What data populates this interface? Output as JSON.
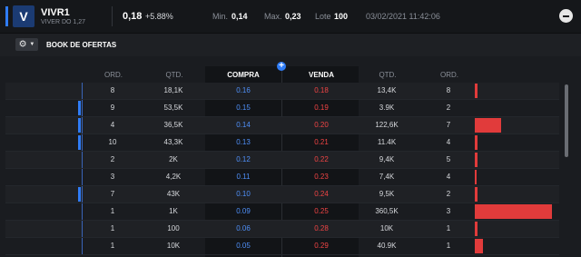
{
  "header": {
    "ticker": "VIVR1",
    "company": "VIVER DO 1,27",
    "logo_glyph": "V",
    "price": "0,18",
    "change": "+5.88%",
    "min_label": "Min.",
    "min_value": "0,14",
    "max_label": "Max.",
    "max_value": "0,23",
    "lote_label": "Lote",
    "lote_value": "100",
    "datetime": "03/02/2021  11:42:06",
    "collapse_icon": "minus-circle-icon"
  },
  "toolbar": {
    "gear_glyph": "⚙",
    "caret_glyph": "▼",
    "title": "BOOK DE OFERTAS"
  },
  "book": {
    "add_glyph": "+",
    "columns": [
      "ORD.",
      "QTD.",
      "COMPRA",
      "VENDA",
      "QTD.",
      "ORD."
    ],
    "rows": [
      {
        "buy_ord": "8",
        "buy_qty": "18,1K",
        "buy_price": "0.16",
        "sell_price": "0.18",
        "sell_qty": "13,4K",
        "sell_ord": "8",
        "mark": false,
        "bar": 0.04
      },
      {
        "buy_ord": "9",
        "buy_qty": "53,5K",
        "buy_price": "0.15",
        "sell_price": "0.19",
        "sell_qty": "3.9K",
        "sell_ord": "2",
        "mark": true,
        "bar": 0.0
      },
      {
        "buy_ord": "4",
        "buy_qty": "36,5K",
        "buy_price": "0.14",
        "sell_price": "0.20",
        "sell_qty": "122,6K",
        "sell_ord": "7",
        "mark": true,
        "bar": 0.34
      },
      {
        "buy_ord": "10",
        "buy_qty": "43,3K",
        "buy_price": "0.13",
        "sell_price": "0.21",
        "sell_qty": "11.4K",
        "sell_ord": "4",
        "mark": true,
        "bar": 0.03
      },
      {
        "buy_ord": "2",
        "buy_qty": "2K",
        "buy_price": "0.12",
        "sell_price": "0.22",
        "sell_qty": "9,4K",
        "sell_ord": "5",
        "mark": false,
        "bar": 0.03
      },
      {
        "buy_ord": "3",
        "buy_qty": "4,2K",
        "buy_price": "0.11",
        "sell_price": "0.23",
        "sell_qty": "7,4K",
        "sell_ord": "4",
        "mark": false,
        "bar": 0.02
      },
      {
        "buy_ord": "7",
        "buy_qty": "43K",
        "buy_price": "0.10",
        "sell_price": "0.24",
        "sell_qty": "9,5K",
        "sell_ord": "2",
        "mark": true,
        "bar": 0.03
      },
      {
        "buy_ord": "1",
        "buy_qty": "1K",
        "buy_price": "0.09",
        "sell_price": "0.25",
        "sell_qty": "360,5K",
        "sell_ord": "3",
        "mark": false,
        "bar": 1.0
      },
      {
        "buy_ord": "1",
        "buy_qty": "100",
        "buy_price": "0.06",
        "sell_price": "0.28",
        "sell_qty": "10K",
        "sell_ord": "1",
        "mark": false,
        "bar": 0.03
      },
      {
        "buy_ord": "1",
        "buy_qty": "10K",
        "buy_price": "0.05",
        "sell_price": "0.29",
        "sell_qty": "40.9K",
        "sell_ord": "1",
        "mark": false,
        "bar": 0.11
      }
    ]
  },
  "colors": {
    "accent": "#2f7cf6",
    "buy": "#4f8ff7",
    "sell": "#f04444",
    "depth_bar": "#e13b3b"
  }
}
